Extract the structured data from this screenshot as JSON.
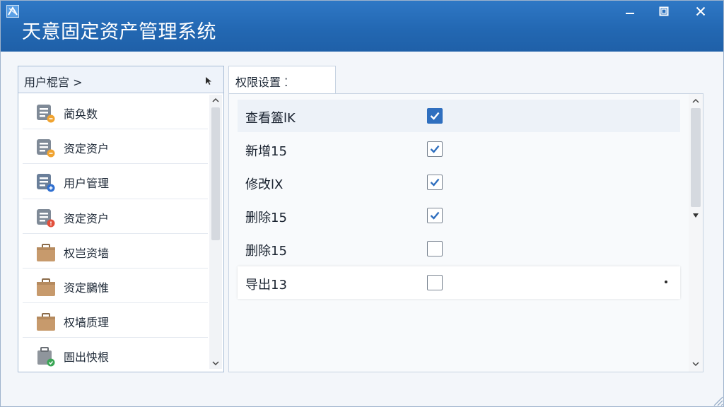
{
  "window": {
    "title": "天意固定资产管理系统",
    "controls": {
      "minimize_icon": "minimize-icon",
      "maximize_icon": "maximize-icon",
      "close_icon": "close-icon"
    }
  },
  "sidebar": {
    "header_label": "用户棍宫 >",
    "items": [
      {
        "label": "蔺奂数",
        "icon": "document-icon",
        "badge_color": "#f0a330"
      },
      {
        "label": "资定资户",
        "icon": "document-icon",
        "badge_color": "#f0a330"
      },
      {
        "label": "用户管理",
        "icon": "document-icon",
        "badge_color": "#2f6fd0"
      },
      {
        "label": "资定资户",
        "icon": "document-icon",
        "badge_color": "#e2503c"
      },
      {
        "label": "权岂资墙",
        "icon": "briefcase-icon"
      },
      {
        "label": "资定鵩惟",
        "icon": "briefcase-icon"
      },
      {
        "label": "权墙质理",
        "icon": "briefcase-icon"
      },
      {
        "label": "圄出怏根",
        "icon": "bag-icon",
        "badge_color": "#3aa655"
      }
    ]
  },
  "tab": {
    "label": "权限设置 ⁚"
  },
  "permissions": [
    {
      "label": "查看篕lK",
      "checked": true,
      "style": "filled"
    },
    {
      "label": "新增15",
      "checked": true,
      "style": "outline"
    },
    {
      "label": "修改lX",
      "checked": true,
      "style": "outline"
    },
    {
      "label": "删除15",
      "checked": true,
      "style": "outline"
    },
    {
      "label": "删除15",
      "checked": false
    },
    {
      "label": "导出13",
      "checked": false
    }
  ],
  "colors": {
    "titlebar": "#2368b3",
    "accent": "#2f6fbf"
  }
}
